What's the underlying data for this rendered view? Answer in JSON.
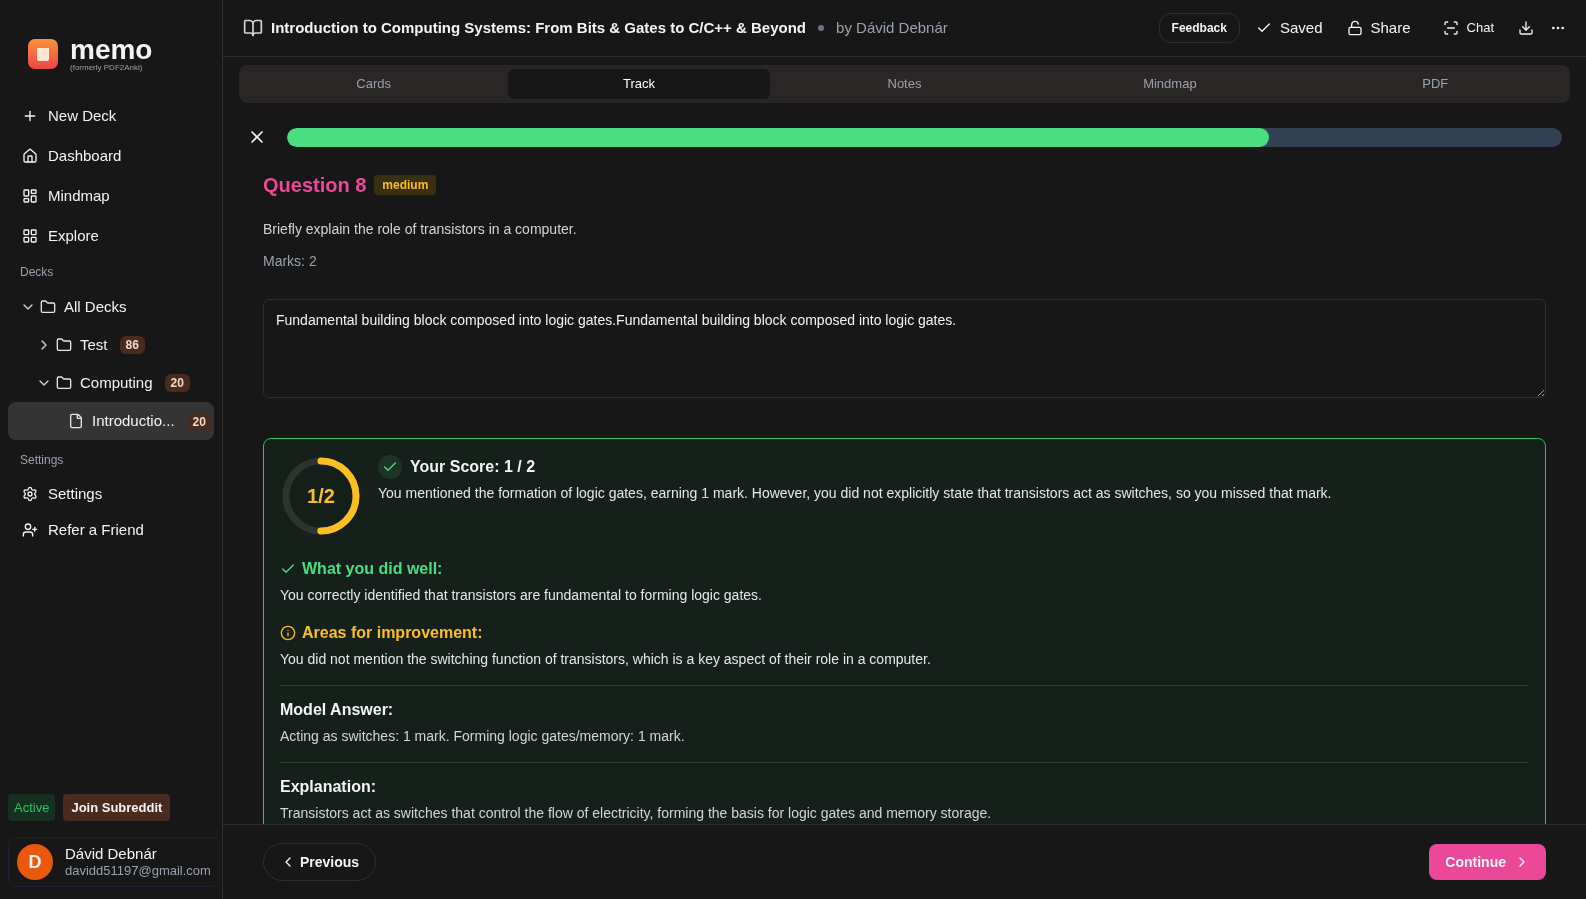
{
  "sidebar": {
    "brand": {
      "name": "memo",
      "subtitle": "(formerly PDF2Anki)"
    },
    "nav": [
      {
        "label": "New Deck"
      },
      {
        "label": "Dashboard"
      },
      {
        "label": "Mindmap"
      },
      {
        "label": "Explore"
      }
    ],
    "decks_heading": "Decks",
    "tree": [
      {
        "label": "All Decks",
        "expanded": true,
        "selected": false,
        "children": [
          {
            "label": "Test",
            "count": "86",
            "expanded": false,
            "selected": false
          },
          {
            "label": "Computing",
            "count": "20",
            "expanded": true,
            "selected": false,
            "children": [
              {
                "label": "Introductio...",
                "count": "20",
                "selected": true
              }
            ]
          }
        ]
      }
    ],
    "settings_heading": "Settings",
    "settings_items": [
      {
        "label": "Settings"
      },
      {
        "label": "Refer a Friend"
      }
    ],
    "status_badge": "Active",
    "subreddit_button": "Join Subreddit",
    "user": {
      "initial": "D",
      "name": "Dávid Debnár",
      "email": "davidd51197@gmail.com"
    }
  },
  "header": {
    "title": "Introduction to Computing Systems: From Bits & Gates to C/C++ & Beyond",
    "author": "by Dávid Debnár",
    "feedback": "Feedback",
    "saved": "Saved",
    "share": "Share",
    "chat": "Chat"
  },
  "tabs": [
    {
      "label": "Cards",
      "selected": false
    },
    {
      "label": "Track",
      "selected": true
    },
    {
      "label": "Notes",
      "selected": false
    },
    {
      "label": "Mindmap",
      "selected": false
    },
    {
      "label": "PDF",
      "selected": false
    }
  ],
  "progress": {
    "level": 0.77
  },
  "question": {
    "title": "Question 8",
    "difficulty": "medium",
    "prompt": "Briefly explain the role of transistors in a computer.",
    "marks": "Marks: 2"
  },
  "answer": {
    "value": "Fundamental building block composed into logic gates.Fundamental building block composed into logic gates."
  },
  "feedback": {
    "ring_label": "1/2",
    "level": 0.5,
    "score": "Your Score: 1 / 2",
    "summary": "You mentioned the formation of logic gates, earning 1 mark. However, you did not explicitly state that transistors act as switches, so you missed that mark.",
    "well_heading": "What you did well:",
    "well_text": "You correctly identified that transistors are fundamental to forming logic gates.",
    "improve_heading": "Areas for improvement:",
    "improve_text": "You did not mention the switching function of transistors, which is a key aspect of their role in a computer.",
    "model_heading": "Model Answer:",
    "model_text": "Acting as switches: 1 mark. Forming logic gates/memory: 1 mark.",
    "explanation_heading": "Explanation:",
    "explanation_text": "Transistors act as switches that control the flow of electricity, forming the basis for logic gates and memory storage."
  },
  "footer": {
    "previous": "Previous",
    "continue": "Continue"
  }
}
